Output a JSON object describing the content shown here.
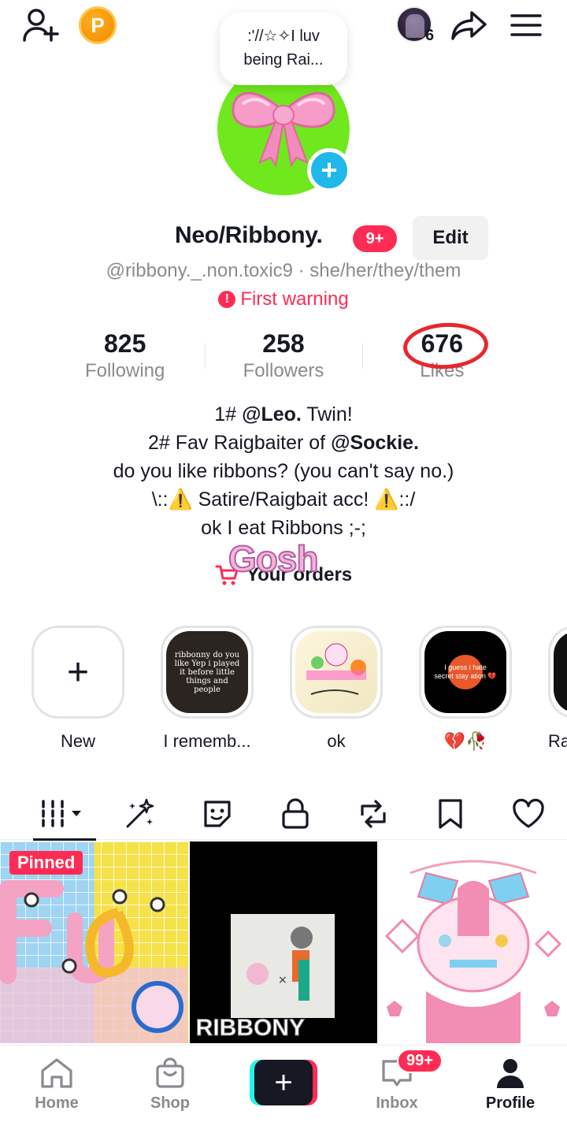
{
  "topbar": {
    "coin_label": "P",
    "profile_views_count": "6"
  },
  "avatar": {
    "note_line1": ":'//☆✧I luv",
    "note_line2": "being Rai...",
    "add_label": "+"
  },
  "profile": {
    "display_name": "Neo/Ribbony.",
    "notification_badge": "9+",
    "edit_label": "Edit",
    "handle": "@ribbony._.non.toxic9 · she/her/they/them",
    "warning": "First warning"
  },
  "stats": {
    "following_count": "825",
    "following_label": "Following",
    "followers_count": "258",
    "followers_label": "Followers",
    "likes_count": "676",
    "likes_label": "Likes"
  },
  "bio": {
    "line1_prefix": "1# ",
    "line1_mention": "@Leo.",
    "line1_suffix": " Twin!",
    "line2_prefix": "2# Fav Raigbaiter of ",
    "line2_mention": "@Sockie.",
    "line3": "do you like ribbons? (you can't say no.)",
    "line4": "\\::⚠️ Satire/Raigbait acc! ⚠️::/",
    "line5": "ok I eat Ribbons ;-;"
  },
  "orders": {
    "label": "Your orders",
    "sticker_text": "Gosh"
  },
  "highlights": [
    {
      "label": "New",
      "thumb_text": ""
    },
    {
      "label": "I rememb...",
      "thumb_text": "ribbonny do you like Yep i played it before little things and people"
    },
    {
      "label": "ok",
      "thumb_text": ""
    },
    {
      "label": "💔🥀",
      "thumb_text": "I guess i hate secret stay ation 💔"
    },
    {
      "label": "Ra",
      "thumb_text": ""
    }
  ],
  "grid": {
    "pinned_label": "Pinned",
    "tile2_caption": "RIBBONY"
  },
  "nav": {
    "home": "Home",
    "shop": "Shop",
    "create": "+",
    "inbox": "Inbox",
    "inbox_badge": "99+",
    "profile": "Profile"
  },
  "colors": {
    "accent": "#fe2c55",
    "secondary_accent": "#25f4ee",
    "text_primary": "#161823",
    "text_secondary": "#8a8b91"
  }
}
